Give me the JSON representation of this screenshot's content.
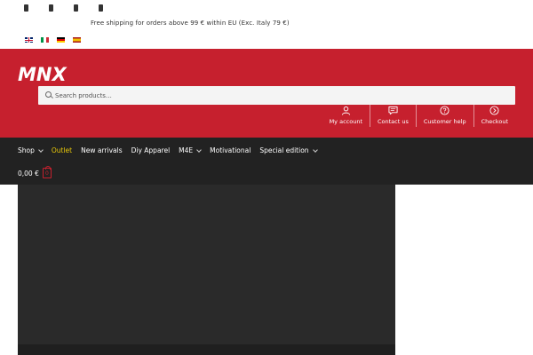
{
  "topbar": {
    "social_icons": [
      "social-icon",
      "social-icon",
      "social-icon",
      "social-icon"
    ],
    "shipping_notice": "Free shipping for orders above 99 € within EU (Exc. Italy 79 €)",
    "languages": [
      "English",
      "Italiano",
      "Deutsch",
      "Español"
    ]
  },
  "header": {
    "logo_text": "MNX",
    "search": {
      "placeholder": "Search products…"
    },
    "links": [
      {
        "label": "My account",
        "icon": "user-icon"
      },
      {
        "label": "Contact us",
        "icon": "chat-icon"
      },
      {
        "label": "Customer help",
        "icon": "help-icon"
      },
      {
        "label": "Checkout",
        "icon": "arrow-right-icon"
      }
    ]
  },
  "nav": {
    "items": [
      {
        "label": "Shop",
        "has_dropdown": true
      },
      {
        "label": "Outlet",
        "active": true
      },
      {
        "label": "New arrivals"
      },
      {
        "label": "Diy Apparel"
      },
      {
        "label": "M4E",
        "has_dropdown": true
      },
      {
        "label": "Motivational"
      },
      {
        "label": "Special edition",
        "has_dropdown": true
      }
    ],
    "cart": {
      "total": "0,00 €",
      "count": "0"
    }
  },
  "colors": {
    "header_red": "#c6202e",
    "nav_dark": "#222222",
    "active_yellow": "#e8c80a"
  }
}
